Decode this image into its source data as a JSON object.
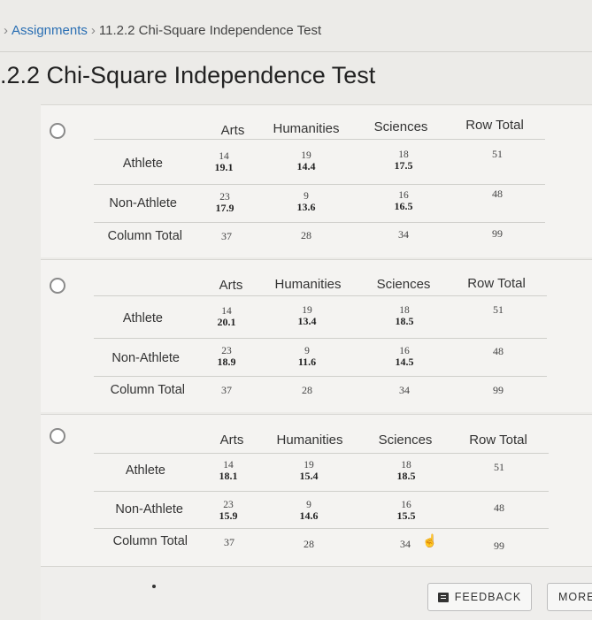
{
  "breadcrumb": {
    "chevron": "›",
    "assignments": "Assignments",
    "separator": "›",
    "current": "11.2.2 Chi-Square Independence Test"
  },
  "page_title": ".2.2 Chi-Square Independence Test",
  "options": [
    {
      "headers": {
        "arts": "Arts",
        "humanities": "Humanities",
        "sciences": "Sciences",
        "row_total": "Row Total"
      },
      "rows": [
        {
          "label": "Athlete",
          "cells": [
            {
              "obs": "14",
              "exp": "19.1"
            },
            {
              "obs": "19",
              "exp": "14.4"
            },
            {
              "obs": "18",
              "exp": "17.5"
            }
          ],
          "total": "51"
        },
        {
          "label": "Non-Athlete",
          "cells": [
            {
              "obs": "23",
              "exp": "17.9"
            },
            {
              "obs": "9",
              "exp": "13.6"
            },
            {
              "obs": "16",
              "exp": "16.5"
            }
          ],
          "total": "48"
        }
      ],
      "column_total": {
        "label": "Column Total",
        "values": [
          "37",
          "28",
          "34"
        ],
        "total": "99"
      }
    },
    {
      "headers": {
        "arts": "Arts",
        "humanities": "Humanities",
        "sciences": "Sciences",
        "row_total": "Row Total"
      },
      "rows": [
        {
          "label": "Athlete",
          "cells": [
            {
              "obs": "14",
              "exp": "20.1"
            },
            {
              "obs": "19",
              "exp": "13.4"
            },
            {
              "obs": "18",
              "exp": "18.5"
            }
          ],
          "total": "51"
        },
        {
          "label": "Non-Athlete",
          "cells": [
            {
              "obs": "23",
              "exp": "18.9"
            },
            {
              "obs": "9",
              "exp": "11.6"
            },
            {
              "obs": "16",
              "exp": "14.5"
            }
          ],
          "total": "48"
        }
      ],
      "column_total": {
        "label": "Column Total",
        "values": [
          "37",
          "28",
          "34"
        ],
        "total": "99"
      }
    },
    {
      "headers": {
        "arts": "Arts",
        "humanities": "Humanities",
        "sciences": "Sciences",
        "row_total": "Row Total"
      },
      "rows": [
        {
          "label": "Athlete",
          "cells": [
            {
              "obs": "14",
              "exp": "18.1"
            },
            {
              "obs": "19",
              "exp": "15.4"
            },
            {
              "obs": "18",
              "exp": "18.5"
            }
          ],
          "total": "51"
        },
        {
          "label": "Non-Athlete",
          "cells": [
            {
              "obs": "23",
              "exp": "15.9"
            },
            {
              "obs": "9",
              "exp": "14.6"
            },
            {
              "obs": "16",
              "exp": "15.5"
            }
          ],
          "total": "48"
        }
      ],
      "column_total": {
        "label": "Column Total",
        "values": [
          "37",
          "28",
          "34"
        ],
        "total": "99"
      }
    }
  ],
  "footer": {
    "feedback_label": "FEEDBACK",
    "more_label": "MORE",
    "feedback_icon": "feedback-icon",
    "cursor_icon": "hand-pointer-icon"
  },
  "colors": {
    "link": "#2a6fb3",
    "background": "#ecebe8",
    "panel": "#f4f3f1"
  }
}
